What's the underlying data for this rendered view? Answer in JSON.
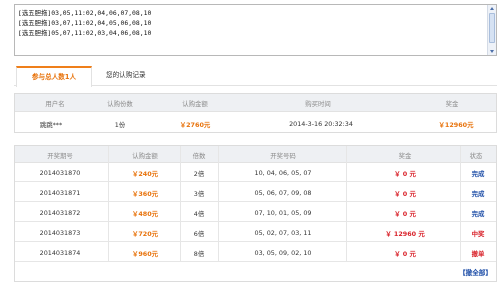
{
  "textarea": {
    "lines": [
      "[选五胆拖]03,05,11:02,04,06,07,08,10",
      "[选五胆拖]03,07,11:02,04,05,06,08,10",
      "[选五胆拖]05,07,11:02,03,04,06,08,10"
    ]
  },
  "tabs": {
    "active": "参与总人数1人",
    "inactive": "您的认购记录"
  },
  "summary": {
    "headers": [
      "用户名",
      "认购份数",
      "认购金额",
      "购买时间",
      "奖金"
    ],
    "row": {
      "user": "跳跳***",
      "shares": "1份",
      "amount": "￥2760元",
      "time": "2014-3-16 20:32:34",
      "prize": "￥12960元"
    }
  },
  "history": {
    "headers": [
      "开奖期号",
      "认购金额",
      "倍数",
      "开奖号码",
      "奖金",
      "状态"
    ],
    "rows": [
      {
        "issue": "2014031870",
        "amount": "￥240元",
        "multiple": "2倍",
        "numbers": "10, 04, 06, 05, 07",
        "prize": "￥ 0 元",
        "status": "完成"
      },
      {
        "issue": "2014031871",
        "amount": "￥360元",
        "multiple": "3倍",
        "numbers": "05, 06, 07, 09, 08",
        "prize": "￥ 0 元",
        "status": "完成"
      },
      {
        "issue": "2014031872",
        "amount": "￥480元",
        "multiple": "4倍",
        "numbers": "07, 10, 01, 05, 09",
        "prize": "￥ 0 元",
        "status": "完成"
      },
      {
        "issue": "2014031873",
        "amount": "￥720元",
        "multiple": "6倍",
        "numbers": "05, 02, 07, 03, 11",
        "prize": "￥ 12960 元",
        "status": "中奖"
      },
      {
        "issue": "2014031874",
        "amount": "￥960元",
        "multiple": "8倍",
        "numbers": "03, 05, 09, 02, 10",
        "prize": "￥ 0 元",
        "status": "撤单"
      }
    ],
    "pager": "【撤全部】"
  },
  "colors": {
    "accent": "#ef7f1a",
    "money": "#e8730c",
    "link": "#1f4fa8",
    "alert": "#d9232b"
  }
}
